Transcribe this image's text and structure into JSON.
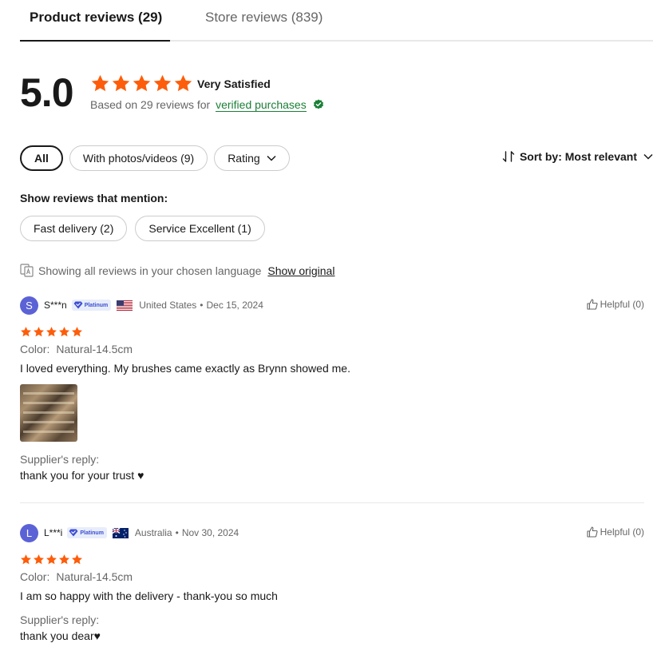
{
  "tabs": {
    "product": "Product reviews (29)",
    "store": "Store reviews (839)"
  },
  "summary": {
    "score": "5.0",
    "stars": 5,
    "satisfaction": "Very Satisfied",
    "based_on": "Based on 29 reviews for",
    "verified_link": "verified purchases"
  },
  "filters": {
    "all": "All",
    "photos": "With photos/videos (9)",
    "rating": "Rating"
  },
  "sort": {
    "label": "Sort by: Most relevant"
  },
  "mentions": {
    "title": "Show reviews that mention:",
    "items": [
      "Fast delivery (2)",
      "Service Excellent (1)"
    ]
  },
  "language_note": {
    "text": "Showing all reviews in your chosen language",
    "link": "Show original"
  },
  "reviews": [
    {
      "avatar_letter": "S",
      "username": "S***n",
      "badge": "Platinum",
      "country": "United States",
      "date": "Dec 15, 2024",
      "meta_sep": "•",
      "helpful": "Helpful (0)",
      "rating": 5,
      "color_label": "Color:",
      "color_value": "Natural-14.5cm",
      "text": "I loved everything. My brushes came exactly as Brynn showed me.",
      "reply_label": "Supplier's reply:",
      "reply_text": "thank you for your trust ♥"
    },
    {
      "avatar_letter": "L",
      "username": "L***i",
      "badge": "Platinum",
      "country": "Australia",
      "date": "Nov 30, 2024",
      "meta_sep": "•",
      "helpful": "Helpful (0)",
      "rating": 5,
      "color_label": "Color:",
      "color_value": "Natural-14.5cm",
      "text": "I am so happy with the delivery - thank-you so much",
      "reply_label": "Supplier's reply:",
      "reply_text": "thank you dear♥"
    }
  ],
  "colors": {
    "star": "#fd5d0a",
    "verified": "#1a7f37",
    "avatar": "#5b62d6",
    "badge": "#3d4fd1"
  }
}
